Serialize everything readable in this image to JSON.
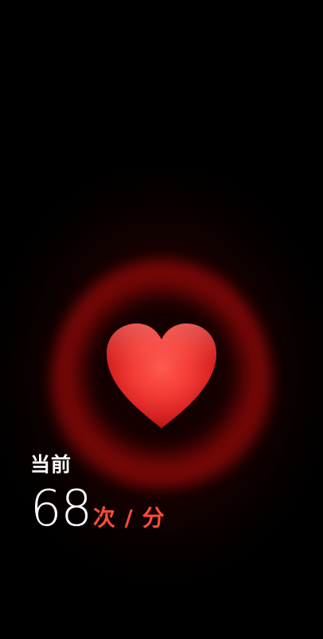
{
  "heart_rate": {
    "label": "当前",
    "value": "68",
    "unit": "次 / 分"
  },
  "colors": {
    "accent": "#ff4c36",
    "heart": "#ff3b30",
    "background": "#000000",
    "text": "#ffffff"
  },
  "icons": {
    "heart": "heart-icon"
  }
}
